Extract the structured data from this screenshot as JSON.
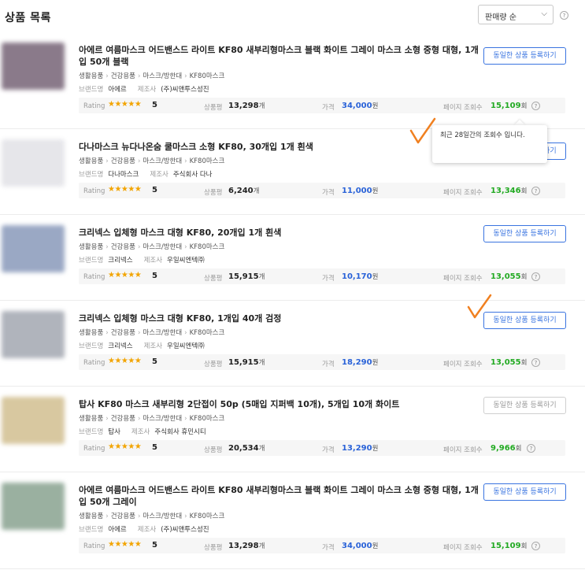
{
  "header": {
    "title": "상품 목록",
    "sort_value": "판매량 순",
    "help_icon": "help-icon"
  },
  "labels": {
    "breadcrumb": [
      "생활용품",
      "건강용품",
      "마스크/방한대",
      "KF80마스크"
    ],
    "brand": "브랜드명",
    "manufacturer": "제조사",
    "rating": "Rating",
    "stars": "★★★★★",
    "reviews": "상품평",
    "price": "가격",
    "views": "페이지 조회수",
    "count_unit": "개",
    "price_unit": "원",
    "view_unit": "회",
    "register_button": "동일한 상품 등록하기"
  },
  "tooltip": {
    "text": "최근 28일간의 조회수 입니다."
  },
  "colors": {
    "accent_blue": "#3a74e0",
    "price_blue": "#2962d8",
    "views_green": "#22aa22",
    "star_gold": "#f2a400",
    "check_orange": "#f08020"
  },
  "products": [
    {
      "title": "아에르 여름마스크 어드밴스드 라이트 KF80 새부리형마스크 블랙 화이트 그레이 마스크 소형 중형 대형, 1개입 50개 블랙",
      "brand": "아에르",
      "manufacturer": "(주)씨앤투스성진",
      "rating": "5",
      "reviews": "13,298",
      "price": "34,000",
      "views": "15,109",
      "button_enabled": true,
      "thumb_color": "#8a7a8a"
    },
    {
      "title": "다나마스크 뉴다나온숨 쿨마스크 소형 KF80, 30개입 1개 흰색",
      "brand": "다나마스크",
      "manufacturer": "주식회사 다나",
      "rating": "5",
      "reviews": "6,240",
      "price": "11,000",
      "views": "13,346",
      "button_enabled": true,
      "thumb_color": "#e6e6ea"
    },
    {
      "title": "크리넥스 입체형 마스크 대형 KF80, 20개입 1개 흰색",
      "brand": "크리넥스",
      "manufacturer": "우일씨엔텍㈜",
      "rating": "5",
      "reviews": "15,915",
      "price": "10,170",
      "views": "13,055",
      "button_enabled": true,
      "thumb_color": "#9aa8c4"
    },
    {
      "title": "크리넥스 입체형 마스크 대형 KF80, 1개입 40개 검정",
      "brand": "크리넥스",
      "manufacturer": "우일씨엔텍㈜",
      "rating": "5",
      "reviews": "15,915",
      "price": "18,290",
      "views": "13,055",
      "button_enabled": true,
      "thumb_color": "#b0b4bc"
    },
    {
      "title": "탑사 KF80 마스크 새부리형 2단접이 50p (5매입 지퍼백 10개), 5개입 10개 화이트",
      "brand": "탑사",
      "manufacturer": "주식회사 휴민시티",
      "rating": "5",
      "reviews": "20,534",
      "price": "13,290",
      "views": "9,966",
      "button_enabled": false,
      "thumb_color": "#d8c8a0"
    },
    {
      "title": "아에르 여름마스크 어드밴스드 라이트 KF80 새부리형마스크 블랙 화이트 그레이 마스크 소형 중형 대형, 1개입 50개 그레이",
      "brand": "아에르",
      "manufacturer": "(주)씨앤투스성진",
      "rating": "5",
      "reviews": "13,298",
      "price": "34,000",
      "views": "15,109",
      "button_enabled": true,
      "thumb_color": "#9ab0a0"
    }
  ]
}
